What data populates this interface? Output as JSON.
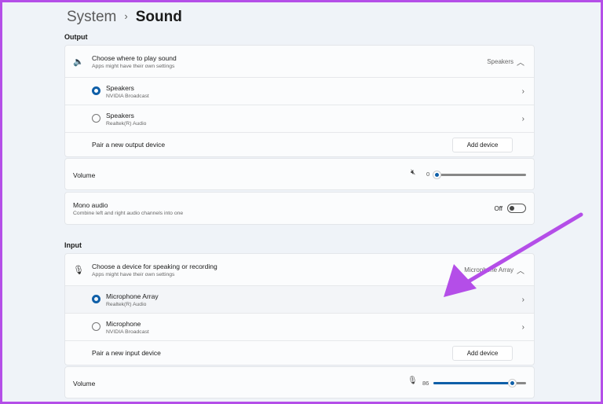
{
  "breadcrumb": {
    "parent": "System",
    "separator": "›",
    "current": "Sound"
  },
  "output": {
    "label": "Output",
    "choose": {
      "title": "Choose where to play sound",
      "subtitle": "Apps might have their own settings",
      "selected": "Speakers"
    },
    "devices": [
      {
        "name": "Speakers",
        "desc": "NVIDIA Broadcast",
        "selected": true
      },
      {
        "name": "Speakers",
        "desc": "Realtek(R) Audio",
        "selected": false
      }
    ],
    "pair": {
      "label": "Pair a new output device",
      "button": "Add device"
    },
    "volume": {
      "label": "Volume",
      "value": "0",
      "percent": 0,
      "icon": "speaker-muted-icon"
    },
    "mono": {
      "title": "Mono audio",
      "subtitle": "Combine left and right audio channels into one",
      "state": "Off"
    }
  },
  "input": {
    "label": "Input",
    "choose": {
      "title": "Choose a device for speaking or recording",
      "subtitle": "Apps might have their own settings",
      "selected": "Microphone Array"
    },
    "devices": [
      {
        "name": "Microphone Array",
        "desc": "Realtek(R) Audio",
        "selected": true
      },
      {
        "name": "Microphone",
        "desc": "NVIDIA Broadcast",
        "selected": false
      }
    ],
    "pair": {
      "label": "Pair a new input device",
      "button": "Add device"
    },
    "volume": {
      "label": "Volume",
      "value": "86",
      "percent": 86,
      "icon": "microphone-icon"
    }
  },
  "annotation": {
    "arrow_color": "#b44ee8"
  }
}
